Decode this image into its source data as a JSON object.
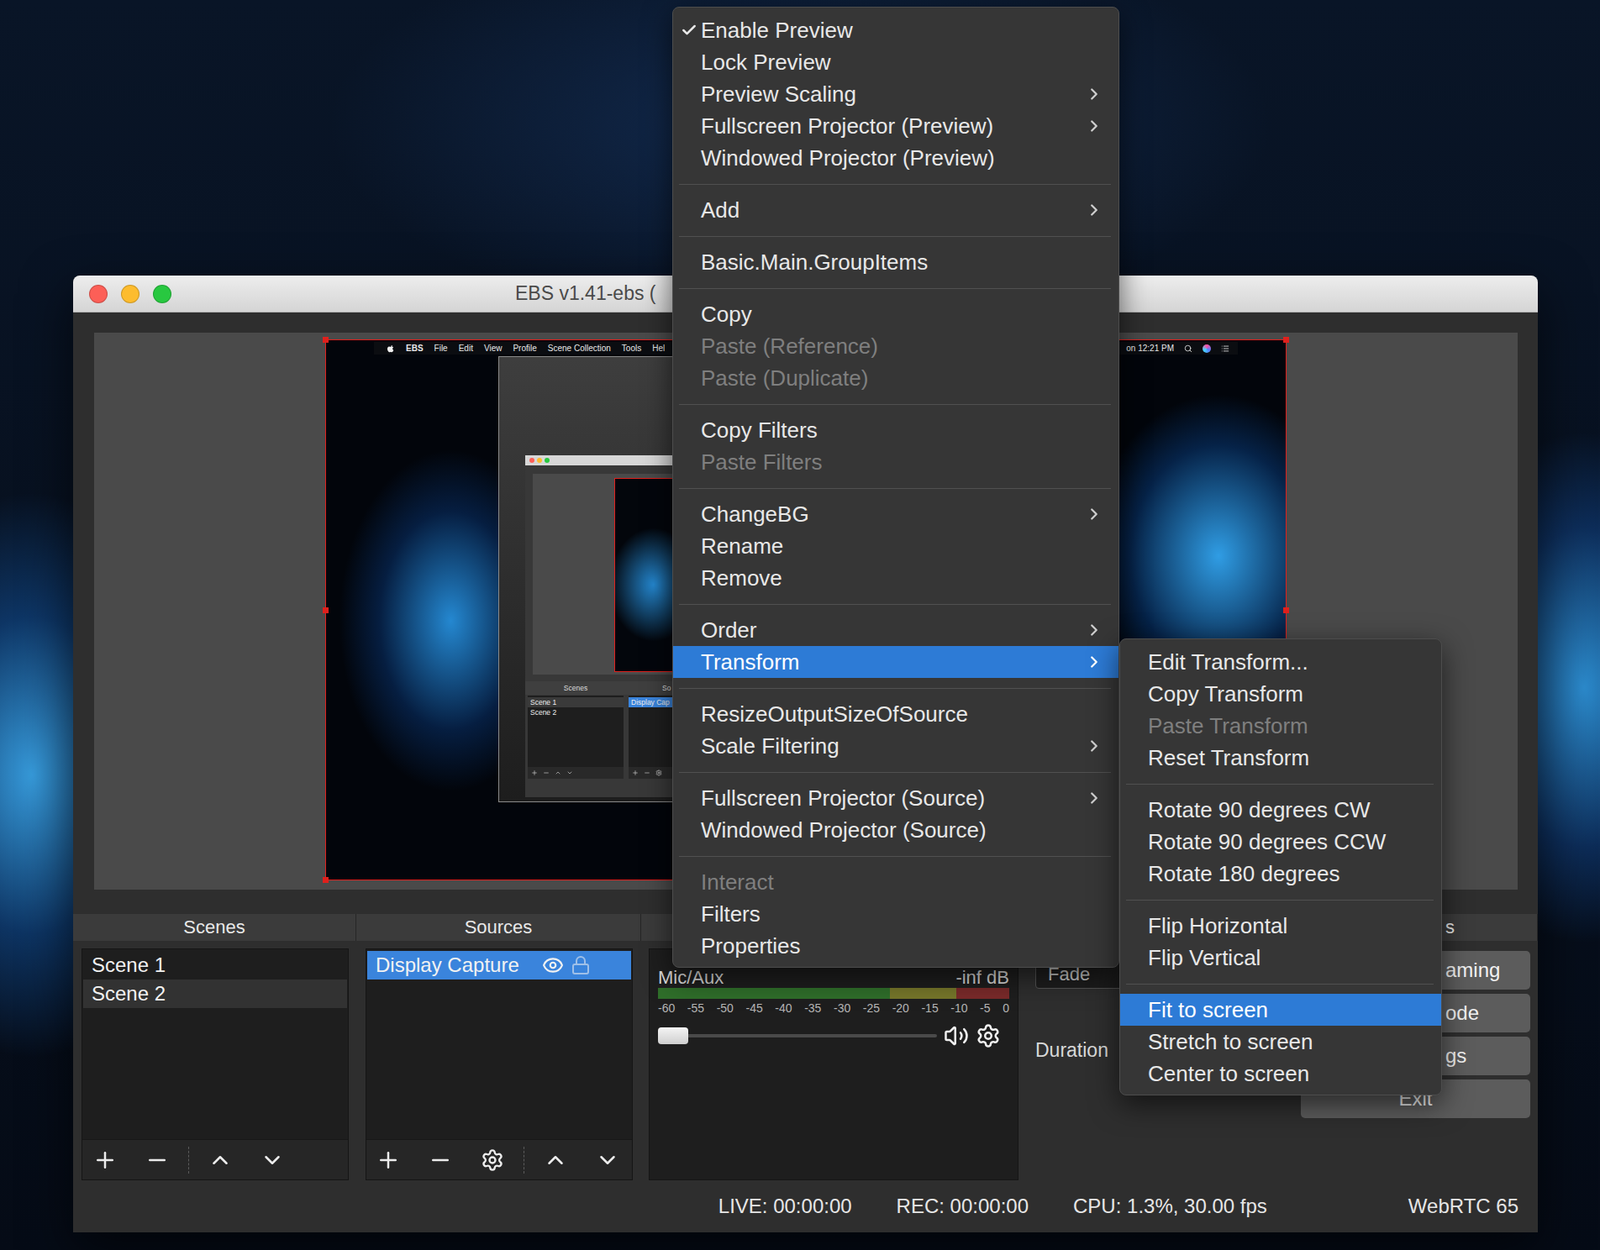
{
  "window": {
    "title": "EBS v1.41-ebs ("
  },
  "preview": {
    "capture": {
      "menubar": {
        "app": "EBS",
        "items": [
          "File",
          "Edit",
          "View",
          "Profile",
          "Scene Collection",
          "Tools",
          "Hel"
        ],
        "clock": "on 12:21 PM"
      },
      "window": {
        "headers": [
          "Scenes",
          "So"
        ],
        "scenes": [
          {
            "label": "Scene 1",
            "selected": true
          },
          {
            "label": "Scene 2",
            "selected": false
          }
        ],
        "sources": [
          {
            "label": "Display Cap",
            "selected": true
          }
        ]
      }
    }
  },
  "context_menu": {
    "items": [
      {
        "kind": "item",
        "label": "Enable Preview",
        "checked": true,
        "disabled": false,
        "submenu": false,
        "selected": false
      },
      {
        "kind": "item",
        "label": "Lock Preview",
        "checked": false,
        "disabled": false,
        "submenu": false,
        "selected": false
      },
      {
        "kind": "item",
        "label": "Preview Scaling",
        "checked": false,
        "disabled": false,
        "submenu": true,
        "selected": false
      },
      {
        "kind": "item",
        "label": "Fullscreen Projector (Preview)",
        "checked": false,
        "disabled": false,
        "submenu": true,
        "selected": false
      },
      {
        "kind": "item",
        "label": "Windowed Projector (Preview)",
        "checked": false,
        "disabled": false,
        "submenu": false,
        "selected": false
      },
      {
        "kind": "separator"
      },
      {
        "kind": "item",
        "label": "Add",
        "checked": false,
        "disabled": false,
        "submenu": true,
        "selected": false
      },
      {
        "kind": "separator"
      },
      {
        "kind": "item",
        "label": "Basic.Main.GroupItems",
        "checked": false,
        "disabled": false,
        "submenu": false,
        "selected": false
      },
      {
        "kind": "separator"
      },
      {
        "kind": "item",
        "label": "Copy",
        "checked": false,
        "disabled": false,
        "submenu": false,
        "selected": false
      },
      {
        "kind": "item",
        "label": "Paste (Reference)",
        "checked": false,
        "disabled": true,
        "submenu": false,
        "selected": false
      },
      {
        "kind": "item",
        "label": "Paste (Duplicate)",
        "checked": false,
        "disabled": true,
        "submenu": false,
        "selected": false
      },
      {
        "kind": "separator"
      },
      {
        "kind": "item",
        "label": "Copy Filters",
        "checked": false,
        "disabled": false,
        "submenu": false,
        "selected": false
      },
      {
        "kind": "item",
        "label": "Paste Filters",
        "checked": false,
        "disabled": true,
        "submenu": false,
        "selected": false
      },
      {
        "kind": "separator"
      },
      {
        "kind": "item",
        "label": "ChangeBG",
        "checked": false,
        "disabled": false,
        "submenu": true,
        "selected": false
      },
      {
        "kind": "item",
        "label": "Rename",
        "checked": false,
        "disabled": false,
        "submenu": false,
        "selected": false
      },
      {
        "kind": "item",
        "label": "Remove",
        "checked": false,
        "disabled": false,
        "submenu": false,
        "selected": false
      },
      {
        "kind": "separator"
      },
      {
        "kind": "item",
        "label": "Order",
        "checked": false,
        "disabled": false,
        "submenu": true,
        "selected": false
      },
      {
        "kind": "item",
        "label": "Transform",
        "checked": false,
        "disabled": false,
        "submenu": true,
        "selected": true
      },
      {
        "kind": "separator"
      },
      {
        "kind": "item",
        "label": "ResizeOutputSizeOfSource",
        "checked": false,
        "disabled": false,
        "submenu": false,
        "selected": false
      },
      {
        "kind": "item",
        "label": "Scale Filtering",
        "checked": false,
        "disabled": false,
        "submenu": true,
        "selected": false
      },
      {
        "kind": "separator"
      },
      {
        "kind": "item",
        "label": "Fullscreen Projector (Source)",
        "checked": false,
        "disabled": false,
        "submenu": true,
        "selected": false
      },
      {
        "kind": "item",
        "label": "Windowed Projector (Source)",
        "checked": false,
        "disabled": false,
        "submenu": false,
        "selected": false
      },
      {
        "kind": "separator"
      },
      {
        "kind": "item",
        "label": "Interact",
        "checked": false,
        "disabled": true,
        "submenu": false,
        "selected": false
      },
      {
        "kind": "item",
        "label": "Filters",
        "checked": false,
        "disabled": false,
        "submenu": false,
        "selected": false
      },
      {
        "kind": "item",
        "label": "Properties",
        "checked": false,
        "disabled": false,
        "submenu": false,
        "selected": false
      }
    ]
  },
  "transform_menu": {
    "items": [
      {
        "kind": "item",
        "label": "Edit Transform...",
        "checked": false,
        "disabled": false,
        "submenu": false,
        "selected": false
      },
      {
        "kind": "item",
        "label": "Copy Transform",
        "checked": false,
        "disabled": false,
        "submenu": false,
        "selected": false
      },
      {
        "kind": "item",
        "label": "Paste Transform",
        "checked": false,
        "disabled": true,
        "submenu": false,
        "selected": false
      },
      {
        "kind": "item",
        "label": "Reset Transform",
        "checked": false,
        "disabled": false,
        "submenu": false,
        "selected": false
      },
      {
        "kind": "separator"
      },
      {
        "kind": "item",
        "label": "Rotate 90 degrees CW",
        "checked": false,
        "disabled": false,
        "submenu": false,
        "selected": false
      },
      {
        "kind": "item",
        "label": "Rotate 90 degrees CCW",
        "checked": false,
        "disabled": false,
        "submenu": false,
        "selected": false
      },
      {
        "kind": "item",
        "label": "Rotate 180 degrees",
        "checked": false,
        "disabled": false,
        "submenu": false,
        "selected": false
      },
      {
        "kind": "separator"
      },
      {
        "kind": "item",
        "label": "Flip Horizontal",
        "checked": false,
        "disabled": false,
        "submenu": false,
        "selected": false
      },
      {
        "kind": "item",
        "label": "Flip Vertical",
        "checked": false,
        "disabled": false,
        "submenu": false,
        "selected": false
      },
      {
        "kind": "separator"
      },
      {
        "kind": "item",
        "label": "Fit to screen",
        "checked": false,
        "disabled": false,
        "submenu": false,
        "selected": true
      },
      {
        "kind": "item",
        "label": "Stretch to screen",
        "checked": false,
        "disabled": false,
        "submenu": false,
        "selected": false
      },
      {
        "kind": "item",
        "label": "Center to screen",
        "checked": false,
        "disabled": false,
        "submenu": false,
        "selected": false
      }
    ]
  },
  "scenes": {
    "title": "Scenes",
    "items": [
      {
        "label": "Scene 1",
        "selected": false
      },
      {
        "label": "Scene 2",
        "selected": true
      }
    ]
  },
  "sources": {
    "title": "Sources",
    "items": [
      {
        "label": "Display Capture",
        "selected": true,
        "visible": true,
        "locked": false
      }
    ]
  },
  "mixer": {
    "channels": [
      {
        "name": "Mic/Aux",
        "reading": "-inf dB",
        "level": 0,
        "volume": 0,
        "muted": false
      }
    ],
    "scale": [
      "-60",
      "-55",
      "-50",
      "-45",
      "-40",
      "-35",
      "-30",
      "-25",
      "-20",
      "-15",
      "-10",
      "-5",
      "0"
    ]
  },
  "transitions": {
    "selected": "Fade",
    "duration_label": "Duration"
  },
  "controls": {
    "title": "s",
    "buttons": [
      {
        "label": "aming",
        "kind": "partial"
      },
      {
        "label": "ode",
        "kind": "partial"
      },
      {
        "label": "gs",
        "kind": "partial"
      },
      {
        "label": "Exit",
        "kind": "full"
      }
    ]
  },
  "status_bar": {
    "live": "LIVE: 00:00:00",
    "rec": "REC: 00:00:00",
    "cpu": "CPU: 1.3%, 30.00 fps",
    "webrtc": "WebRTC 65"
  }
}
